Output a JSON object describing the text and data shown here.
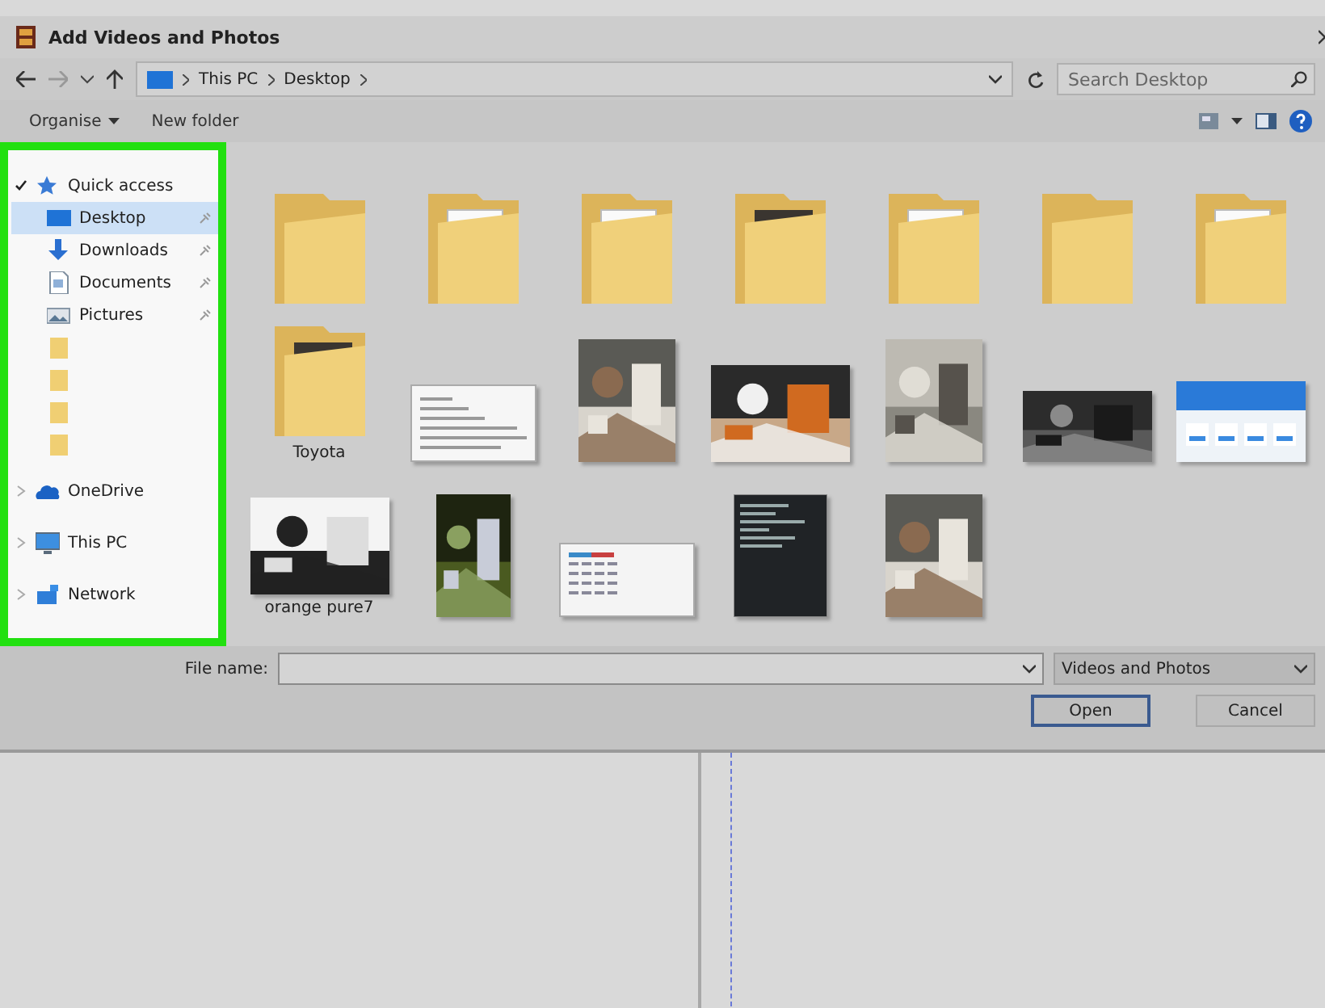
{
  "window": {
    "title": "Add Videos and Photos"
  },
  "address": {
    "path": [
      "This PC",
      "Desktop"
    ]
  },
  "search": {
    "placeholder": "Search Desktop"
  },
  "toolbar": {
    "buttons": [
      {
        "label": "Organise",
        "dropdown": true
      },
      {
        "label": "New folder",
        "dropdown": false
      }
    ]
  },
  "sidebar": {
    "highlighted": true,
    "items": [
      {
        "label": "Quick access",
        "kind": "star",
        "selected": false,
        "expanded": true,
        "children": [
          {
            "label": "Desktop",
            "kind": "desktop",
            "selected": true,
            "pinned": true
          },
          {
            "label": "Downloads",
            "kind": "download",
            "selected": false,
            "pinned": true
          },
          {
            "label": "Documents",
            "kind": "document",
            "selected": false,
            "pinned": true
          },
          {
            "label": "Pictures",
            "kind": "pictures",
            "selected": false,
            "pinned": true
          },
          {
            "kind": "folder",
            "selected": false,
            "pinned": false
          },
          {
            "kind": "folder",
            "selected": false,
            "pinned": false
          },
          {
            "kind": "folder",
            "selected": false,
            "pinned": false
          },
          {
            "kind": "folder",
            "selected": false,
            "pinned": false
          }
        ]
      },
      {
        "label": "OneDrive",
        "kind": "cloud",
        "selected": false,
        "expanded": false
      },
      {
        "label": "This PC",
        "kind": "pc",
        "selected": false,
        "expanded": false
      },
      {
        "label": "Network",
        "kind": "network",
        "selected": false,
        "expanded": false
      }
    ]
  },
  "files": [
    {
      "kind": "folder"
    },
    {
      "kind": "folder-document"
    },
    {
      "kind": "folder-document"
    },
    {
      "kind": "folder-picture"
    },
    {
      "kind": "folder-document"
    },
    {
      "kind": "folder"
    },
    {
      "kind": "folder-document"
    },
    {
      "kind": "folder-picture",
      "label": "Toyota"
    },
    {
      "kind": "document"
    },
    {
      "kind": "picture"
    },
    {
      "kind": "picture"
    },
    {
      "kind": "picture"
    },
    {
      "kind": "picture"
    },
    {
      "kind": "web"
    },
    {
      "kind": "picture",
      "label": "orange pure7"
    },
    {
      "kind": "picture"
    },
    {
      "kind": "sheet"
    },
    {
      "kind": "terminal"
    },
    {
      "kind": "picture"
    }
  ],
  "footer": {
    "file_name_label": "File name:",
    "file_type": "Videos and Photos",
    "buttons": [
      {
        "label": "Open",
        "default": true
      },
      {
        "label": "Cancel",
        "default": false
      }
    ]
  }
}
